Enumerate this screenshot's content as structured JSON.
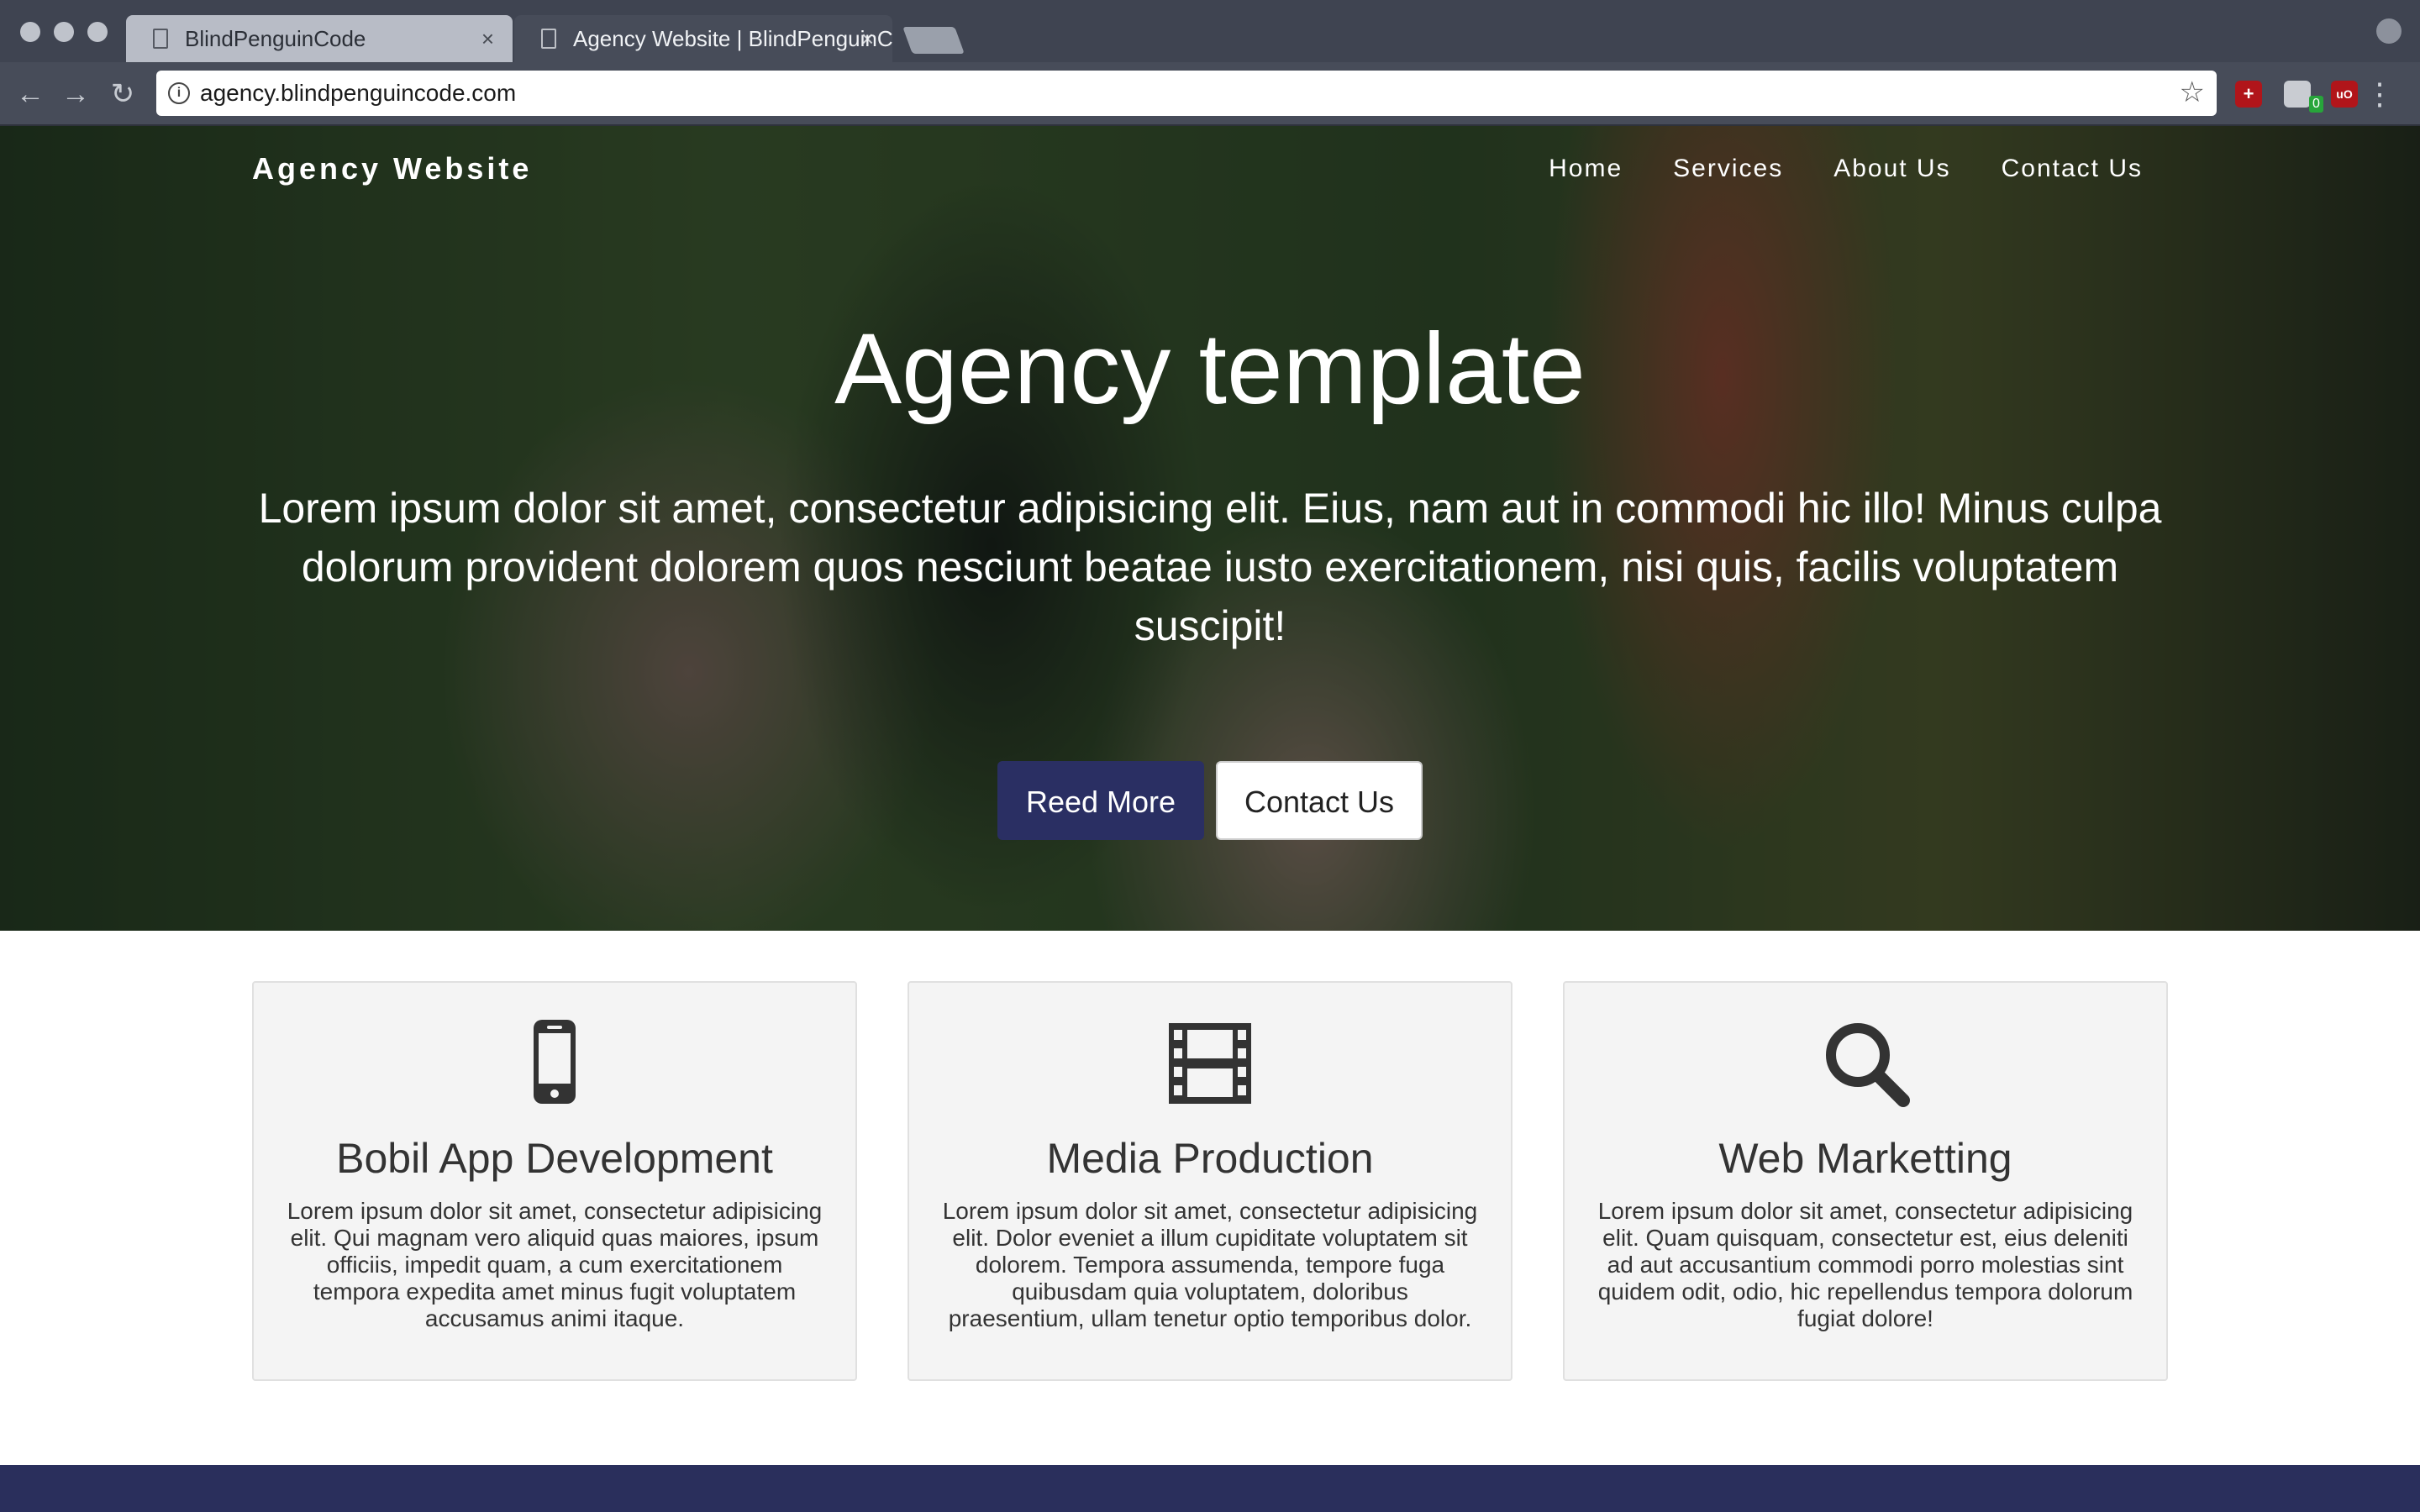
{
  "browser": {
    "tabs": [
      {
        "title": "BlindPenguinCode",
        "active": false
      },
      {
        "title": "Agency Website | BlindPenguinCode",
        "active": true
      }
    ],
    "tab_close_glyph": "×",
    "url": "agency.blindpenguincode.com",
    "extension_badge": "0"
  },
  "site": {
    "brand": "Agency Website",
    "nav": [
      "Home",
      "Services",
      "About Us",
      "Contact Us"
    ]
  },
  "hero": {
    "title": "Agency template",
    "text": "Lorem ipsum dolor sit amet, consectetur adipisicing elit. Eius, nam aut in commodi hic illo! Minus culpa dolorum provident dolorem quos nesciunt beatae iusto exercitationem, nisi quis, facilis voluptatem suscipit!",
    "primary_button": "Reed More",
    "secondary_button": "Contact Us"
  },
  "services": [
    {
      "icon": "mobile-phone-icon",
      "title": "Bobil App Development",
      "text": "Lorem ipsum dolor sit amet, consectetur adipisicing elit. Qui magnam vero aliquid quas maiores, ipsum officiis, impedit quam, a cum exercitationem tempora expedita amet minus fugit voluptatem accusamus animi itaque."
    },
    {
      "icon": "film-icon",
      "title": "Media Production",
      "text": "Lorem ipsum dolor sit amet, consectetur adipisicing elit. Dolor eveniet a illum cupiditate voluptatem sit dolorem. Tempora assumenda, tempore fuga quibusdam quia voluptatem, doloribus praesentium, ullam tenetur optio temporibus dolor."
    },
    {
      "icon": "search-icon",
      "title": "Web Marketting",
      "text": "Lorem ipsum dolor sit amet, consectetur adipisicing elit. Quam quisquam, consectetur est, eius deleniti ad aut accusantium commodi porro molestias sint quidem odit, odio, hic repellendus tempora dolorum fugiat dolore!"
    }
  ],
  "colors": {
    "primary": "#2a2f63",
    "footer": "#2a2f5c",
    "card_bg": "#f4f4f4"
  }
}
